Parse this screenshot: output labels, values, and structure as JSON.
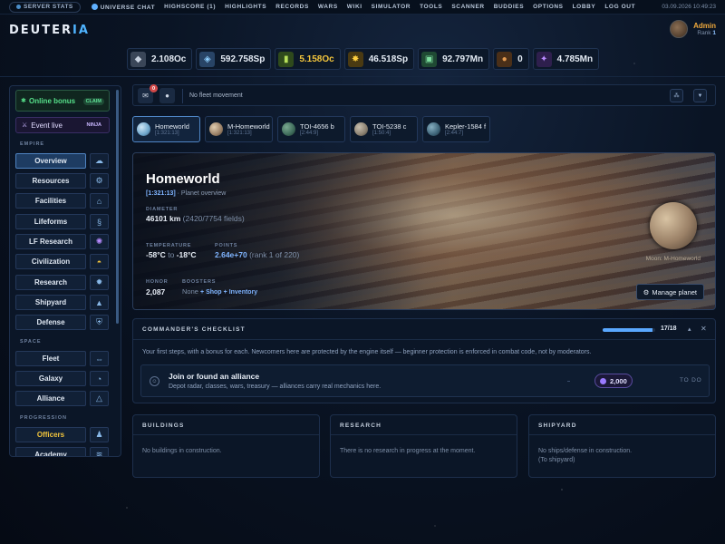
{
  "topnav": {
    "server_stats": "SERVER STATS",
    "links": [
      "UNIVERSE CHAT",
      "HIGHSCORE (1)",
      "HIGHLIGHTS",
      "RECORDS",
      "WARS",
      "WIKI",
      "SIMULATOR",
      "TOOLS",
      "SCANNER",
      "BUDDIES",
      "OPTIONS",
      "LOBBY",
      "LOG OUT"
    ],
    "datetime": "03.09.2026 10:49:23"
  },
  "logo": {
    "main": "DEUTER",
    "accent": "IA"
  },
  "user": {
    "name": "Admin",
    "rank_label": "Rank",
    "rank": "1"
  },
  "resources": [
    {
      "icon": "metal-icon",
      "value": "2.108Oc"
    },
    {
      "icon": "crystal-icon",
      "value": "592.758Sp"
    },
    {
      "icon": "deuterium-icon",
      "value": "5.158Oc",
      "highlight": true
    },
    {
      "icon": "energy-icon",
      "value": "46.518Sp"
    },
    {
      "icon": "population-icon",
      "value": "92.797Mn"
    },
    {
      "icon": "food-icon",
      "value": "0"
    },
    {
      "icon": "dark-matter-icon",
      "value": "4.785Mn"
    }
  ],
  "sidebar": {
    "online_bonus": "Online bonus",
    "claim": "CLAIM",
    "event": "Event live",
    "event_badge": "NINJA",
    "sections": {
      "empire": "EMPIRE",
      "space": "SPACE",
      "progression": "PROGRESSION"
    },
    "empire": [
      "Overview",
      "Resources",
      "Facilities",
      "Lifeforms",
      "LF Research",
      "Civilization",
      "Research",
      "Shipyard",
      "Defense"
    ],
    "space": [
      "Fleet",
      "Galaxy",
      "Alliance"
    ],
    "progression": [
      "Officers",
      "Academy"
    ]
  },
  "fleet_bar": {
    "status": "No fleet movement",
    "notification_count": "0"
  },
  "planets": [
    {
      "name": "Homeworld",
      "coords": "[1:321:13]",
      "color": "#9cc8e6"
    },
    {
      "name": "M-Homeworld",
      "coords": "[1:321:13]",
      "color": "#b59a7a"
    },
    {
      "name": "TOI-4656 b",
      "coords": "[2:44:9]",
      "color": "#3e6b5a"
    },
    {
      "name": "TOI-5238 c",
      "coords": "[1:50:4]",
      "color": "#8a8070"
    },
    {
      "name": "Kepler-1584 f",
      "coords": "[2:44:7]",
      "color": "#3e6478"
    }
  ],
  "overview": {
    "title": "Homeworld",
    "coords": "[1:321:13]",
    "subtitle": "· Planet overview",
    "diameter_label": "DIAMETER",
    "diameter": "46101 km",
    "fields": "(2420/7754 fields)",
    "temperature_label": "TEMPERATURE",
    "temp_min": "-58°C",
    "temp_to": "to",
    "temp_max": "-18°C",
    "points_label": "POINTS",
    "points": "2.64e+70",
    "points_rank": "(rank 1 of 220)",
    "honor_label": "HONOR",
    "honor": "2,087",
    "boosters_label": "BOOSTERS",
    "boosters": "None",
    "shop_link": "+ Shop",
    "inventory_link": "+ Inventory",
    "moon_label": "Moon: M-Homeworld",
    "manage_button": "Manage planet"
  },
  "checklist": {
    "title": "COMMANDER'S CHECKLIST",
    "progress": "17/18",
    "progress_fraction": 0.944,
    "description": "Your first steps, with a bonus for each. Newcomers here are protected by the engine itself — beginner protection is enforced in combat code, not by moderators.",
    "task": {
      "title": "Join or found an alliance",
      "desc": "Depot radar, classes, wars, treasury — alliances carry real mechanics here.",
      "reward": "2,000",
      "status": "TO DO"
    }
  },
  "panels": {
    "buildings": {
      "title": "BUILDINGS",
      "text": "No buildings in construction."
    },
    "research": {
      "title": "RESEARCH",
      "text": "There is no research in progress at the moment."
    },
    "shipyard": {
      "title": "SHIPYARD",
      "text": "No ships/defense in construction.",
      "text2": "(To shipyard)"
    }
  }
}
